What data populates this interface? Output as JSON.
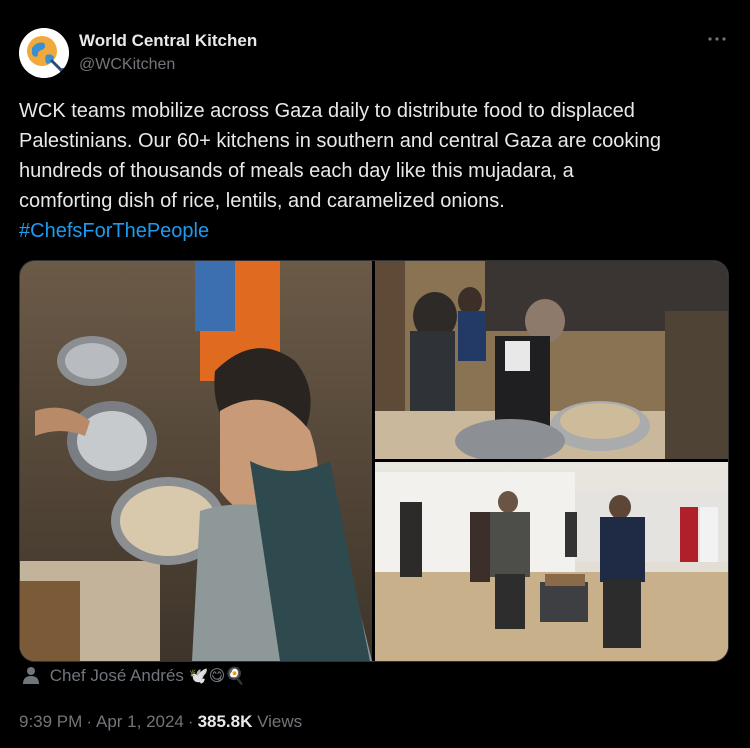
{
  "author": {
    "name": "World Central Kitchen",
    "handle": "@WCKitchen"
  },
  "tweet": {
    "lines": [
      "WCK teams mobilize across Gaza daily to distribute food to displaced",
      "Palestinians. Our 60+ kitchens in southern and central Gaza are cooking",
      "hundreds of thousands of meals each day like this mujadara, a",
      "comforting dish of rice, lentils, and caramelized onions."
    ],
    "hashtag": "#ChefsForThePeople"
  },
  "tagged": {
    "name": "Chef José Andrés",
    "emojis": "🕊️😋🍳"
  },
  "meta": {
    "time": "9:39 PM",
    "date": "Apr 1, 2024",
    "views_count": "385.8K",
    "views_label": "Views"
  },
  "colors": {
    "background": "#000000",
    "text": "#e7e9ea",
    "muted": "#71767b",
    "link": "#1d9bf0"
  },
  "icons": {
    "more": "more-horizontal-icon",
    "tagged": "person-icon"
  }
}
